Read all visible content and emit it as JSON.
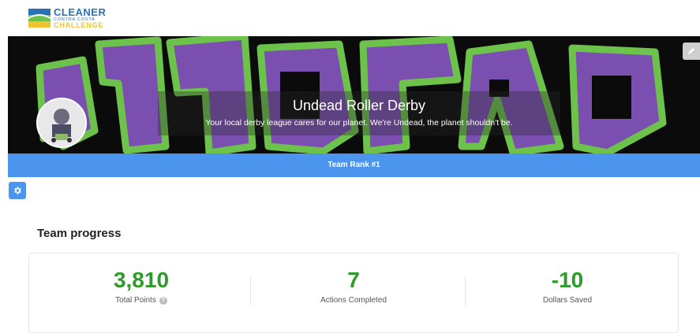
{
  "logo": {
    "line1": "CLEANER",
    "line2": "CONTRA COSTA",
    "line3": "CHALLENGE"
  },
  "banner": {
    "team_name": "Undead Roller Derby",
    "description": "Your local derby league cares for our planet. We're Undead, the planet shouldn't be.",
    "colors": {
      "purple": "#7b4fb0",
      "green": "#6cc24a",
      "background": "#0b0b0b"
    }
  },
  "rank": {
    "label": "Team Rank #1"
  },
  "progress": {
    "title": "Team progress",
    "stats": [
      {
        "value": "3,810",
        "label": "Total Points"
      },
      {
        "value": "7",
        "label": "Actions Completed"
      },
      {
        "value": "-10",
        "label": "Dollars Saved"
      }
    ]
  },
  "icons": {
    "edit": "pencil-icon",
    "settings": "gear-icon",
    "info": "info-icon"
  },
  "colors": {
    "accent": "#4c95ee",
    "stat_green": "#2e9a2a"
  }
}
